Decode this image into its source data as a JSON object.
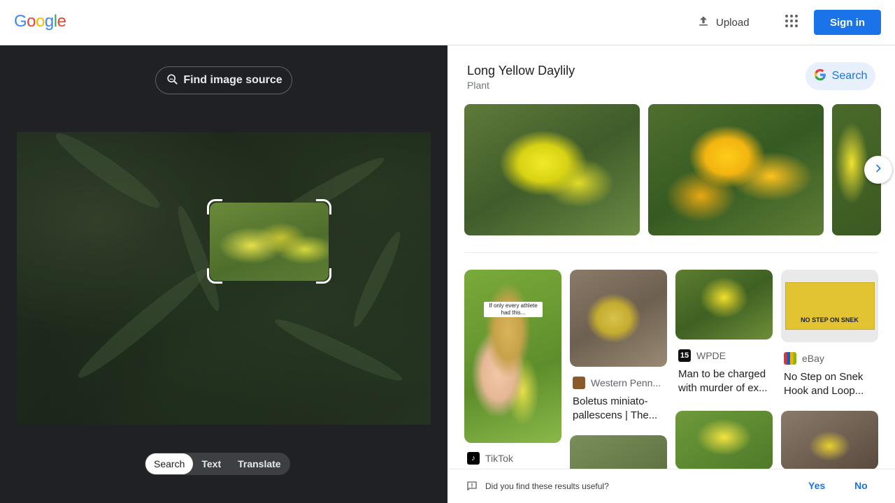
{
  "header": {
    "logo_letters": [
      {
        "ch": "G",
        "color": "#4285f4"
      },
      {
        "ch": "o",
        "color": "#ea4335"
      },
      {
        "ch": "o",
        "color": "#fbbc05"
      },
      {
        "ch": "g",
        "color": "#4285f4"
      },
      {
        "ch": "l",
        "color": "#34a853"
      },
      {
        "ch": "e",
        "color": "#ea4335"
      }
    ],
    "upload_label": "Upload",
    "signin_label": "Sign in",
    "accent": "#1a73e8"
  },
  "left": {
    "find_source_label": "Find image source",
    "modes": [
      {
        "label": "Search",
        "active": true
      },
      {
        "label": "Text",
        "active": false
      },
      {
        "label": "Translate",
        "active": false
      }
    ]
  },
  "entity": {
    "title": "Long Yellow Daylily",
    "subtitle": "Plant",
    "search_label": "Search"
  },
  "results": [
    {
      "source": "TikTok",
      "icon_color": "#000000",
      "icon_char": "♪",
      "caption_lines": [],
      "overlay": "If only every athlete had this..."
    },
    {
      "source": "Western Penn...",
      "icon_color": "#8a5a2a",
      "icon_char": "",
      "caption_lines": [
        "Boletus miniato-",
        "pallescens | The..."
      ]
    },
    {
      "source": "WPDE",
      "icon_color": "#111111",
      "icon_char": "15",
      "caption_lines": [
        "Man to be charged",
        "with murder of ex..."
      ]
    },
    {
      "source": "eBay",
      "icon_color": "#e53238",
      "icon_char": "",
      "caption_lines": [
        "No Step on Snek",
        "Hook and Loop..."
      ],
      "flag_text": "NO STEP ON SNEK"
    }
  ],
  "feedback": {
    "question": "Did you find these results useful?",
    "yes": "Yes",
    "no": "No"
  }
}
